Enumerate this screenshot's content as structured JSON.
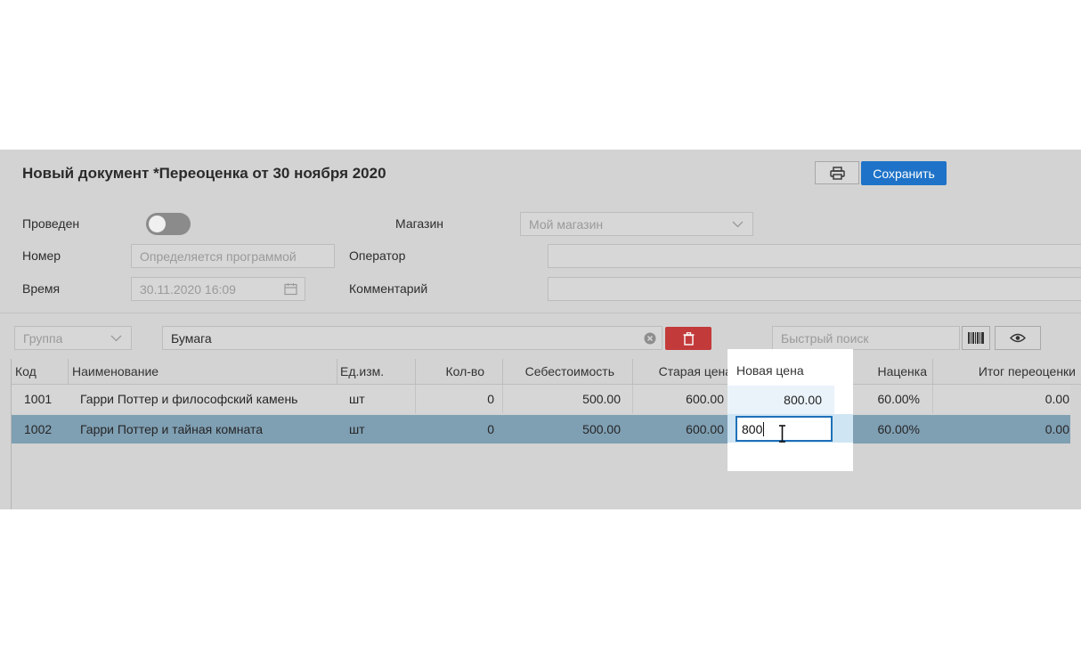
{
  "header": {
    "title": "Новый документ *Переоценка от 30 ноября 2020",
    "save_label": "Сохранить"
  },
  "form": {
    "posted_label": "Проведен",
    "number_label": "Номер",
    "number_placeholder": "Определяется программой",
    "time_label": "Время",
    "time_value": "30.11.2020 16:09",
    "store_label": "Магазин",
    "store_value": "Мой магазин",
    "operator_label": "Оператор",
    "operator_value": "",
    "comment_label": "Комментарий",
    "comment_value": ""
  },
  "toolbar": {
    "group_placeholder": "Группа",
    "group_filter_value": "Бумага",
    "quick_search_placeholder": "Быстрый поиск"
  },
  "table": {
    "columns": [
      "Код",
      "Наименование",
      "Ед.изм.",
      "Кол-во",
      "Себестоимость",
      "Старая цена",
      "Новая цена",
      "Наценка",
      "Итог переоценки"
    ],
    "rows": [
      {
        "code": "1001",
        "name": "Гарри Поттер и философский камень",
        "unit": "шт",
        "qty": "0",
        "cost": "500.00",
        "old_price": "600.00",
        "new_price": "800.00",
        "markup": "60.00%",
        "total": "0.00"
      },
      {
        "code": "1002",
        "name": "Гарри Поттер и тайная комната",
        "unit": "шт",
        "qty": "0",
        "cost": "500.00",
        "old_price": "600.00",
        "new_price": "800",
        "markup": "60.00%",
        "total": "0.00"
      }
    ]
  },
  "colors": {
    "accent": "#1e73c8",
    "danger": "#c33a3a",
    "selected_row": "#7f9fb3"
  }
}
